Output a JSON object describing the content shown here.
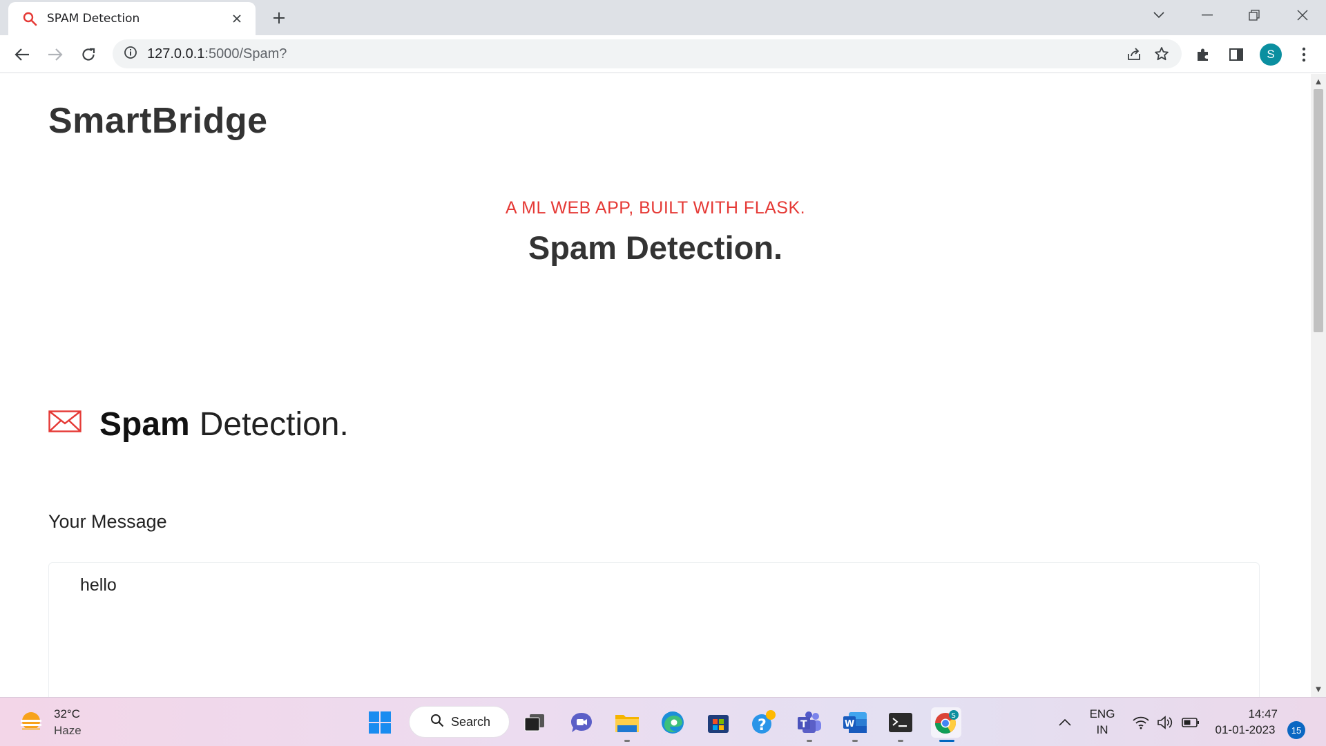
{
  "browser": {
    "tab_title": "SPAM Detection",
    "url_host": "127.0.0.1",
    "url_rest": ":5000/Spam?",
    "profile_initial": "S"
  },
  "page": {
    "brand": "SmartBridge",
    "subtitle": "A ML WEB APP, BUILT WITH FLASK.",
    "headline": "Spam Detection.",
    "section_bold": "Spam",
    "section_light": "Detection.",
    "message_label": "Your Message",
    "message_value": "hello",
    "accent_color": "#e53935"
  },
  "taskbar": {
    "weather_temp": "32°C",
    "weather_condition": "Haze",
    "search_label": "Search",
    "language_line1": "ENG",
    "language_line2": "IN",
    "time": "14:47",
    "date": "01-01-2023",
    "notification_count": "15",
    "pinned_apps": [
      "start-icon",
      "search",
      "task-view-icon",
      "chat-icon",
      "file-explorer-icon",
      "edge-icon",
      "store-icon",
      "help-icon",
      "teams-icon",
      "word-icon",
      "terminal-icon",
      "chrome-icon"
    ]
  }
}
